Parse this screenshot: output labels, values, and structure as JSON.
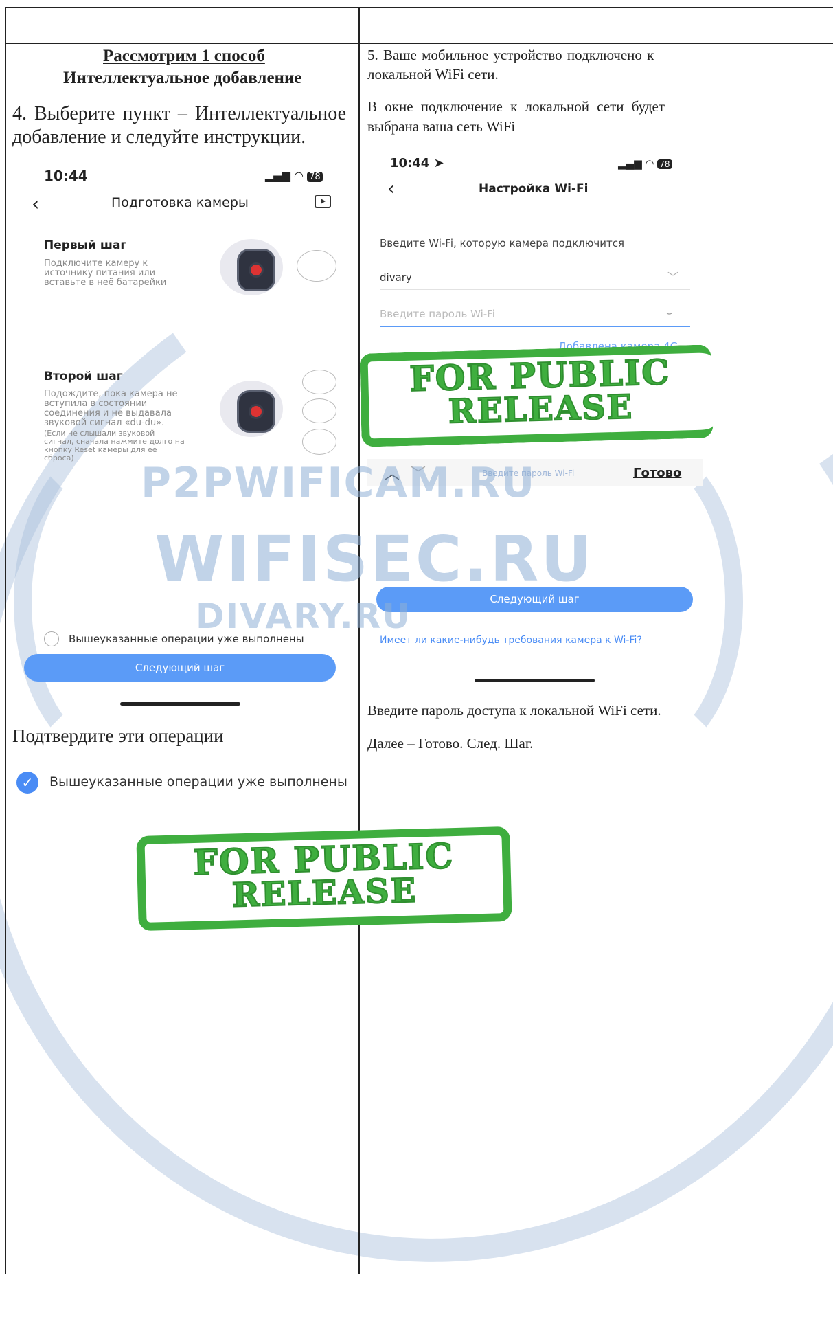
{
  "left_column": {
    "method_heading": "Рассмотрим 1 способ",
    "method_subheading": "Интеллектуальное добавление",
    "step4_text_line1": "4. Выберите пункт – Интеллектуальное",
    "step4_text_line2": "добавление и следуйте инструкции.",
    "phone": {
      "time": "10:44",
      "battery": "78",
      "title": "Подготовка камеры",
      "step1_title": "Первый шаг",
      "step1_line1": "Подключите камеру к",
      "step1_line2": "источнику питания или",
      "step1_line3": "вставьте в неё батарейки",
      "step2_title": "Второй шаг",
      "step2_line1": "Подождите, пока камера не",
      "step2_line2": "вступила в состоянии",
      "step2_line3": "соединения и не выдавала",
      "step2_line4": "звуковой сигнал «du-du».",
      "step2_note1": "(Если не слышали звуковой",
      "step2_note2": "сигнал, сначала нажмите долго на",
      "step2_note3": "кнопку Reset камеры для её",
      "step2_note4": "сброса)",
      "checkbox_label": "Вышеуказанные операции уже выполнены",
      "next_button": "Следующий шаг"
    },
    "confirm_text": "Подтвердите эти операции",
    "confirmed_checkbox_label": "Вышеуказанные операции уже выполнены"
  },
  "right_column": {
    "step5_line1": "5. Ваше мобильное устройство подключено к",
    "step5_line2": "локальной WiFi сети.",
    "wifi_note_line1": "В окне подключение к локальной сети будет",
    "wifi_note_line2": "выбрана ваша сеть WiFi",
    "phone": {
      "time": "10:44",
      "battery": "78",
      "title": "Настройка Wi-Fi",
      "prompt": "Введите Wi-Fi, которую камера подключится",
      "ssid_value": "divary",
      "password_placeholder": "Введите пароль Wi-Fi",
      "partial_link": "Добавлена камера 4G",
      "keyboard_field_placeholder": "Введите пароль Wi-Fi",
      "done_button": "Готово",
      "next_button": "Следующий шаг",
      "requirements_link": "Имеет ли какие-нибудь требования камера к Wi-Fi?"
    },
    "password_text": "Введите пароль доступа к локальной WiFi сети.",
    "next_text": "Далее – Готово. След. Шаг."
  },
  "stamps": {
    "line1": "FOR PUBLIC",
    "line2": "RELEASE"
  },
  "watermarks": {
    "site1": "P2PWIFICAM.RU",
    "site2": "WIFISEC.RU",
    "site3": "DIVARY.RU"
  },
  "colors": {
    "accent_blue": "#5b9bf7",
    "stamp_green": "#3fae3f",
    "watermark_blue": "#8fb0d6"
  }
}
